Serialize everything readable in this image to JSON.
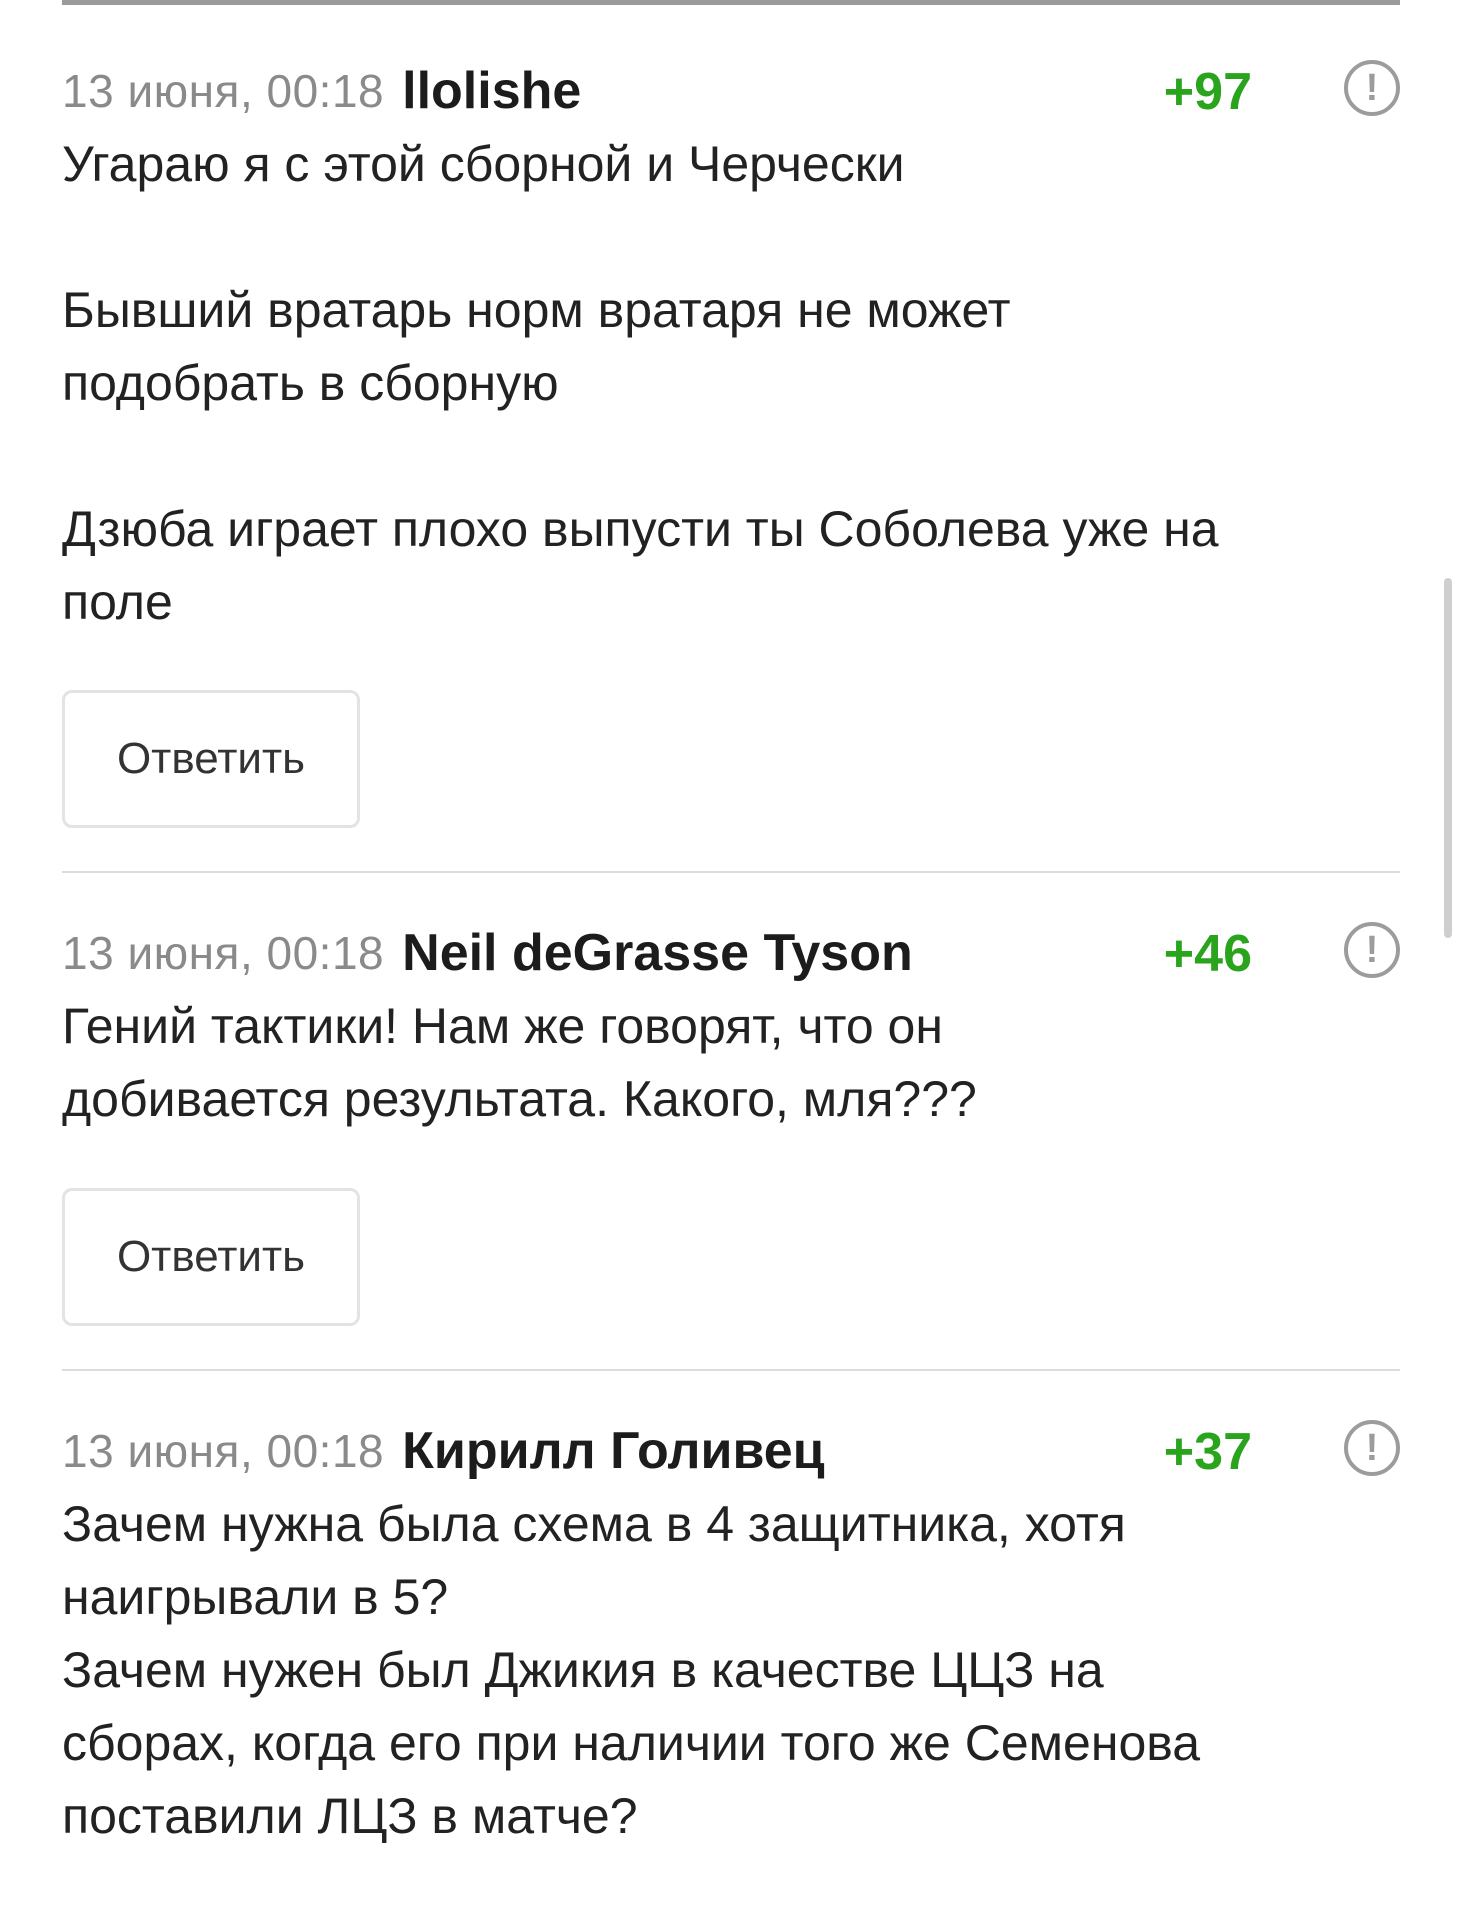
{
  "reply_label": "Ответить",
  "report_symbol": "!",
  "colors": {
    "rating_positive": "#2aa31d",
    "date": "#8a8a8a",
    "text": "#222222"
  },
  "comments": [
    {
      "date": "13 июня, 00:18",
      "author": "llolishe",
      "rating": "+97",
      "lines": [
        "Угараю я с этой сборной и Черчески",
        "",
        "Бывший вратарь норм вратаря не может",
        "подобрать в сборную",
        "",
        "Дзюба играет плохо выпусти ты Соболева уже на",
        "поле"
      ]
    },
    {
      "date": "13 июня, 00:18",
      "author": "Neil deGrasse Tyson",
      "rating": "+46",
      "lines": [
        "Гений тактики! Нам же говорят, что он",
        "добивается результата. Какого, мля???"
      ]
    },
    {
      "date": "13 июня, 00:18",
      "author": "Кирилл Голивец",
      "rating": "+37",
      "lines": [
        "Зачем нужна была схема в 4 защитника, хотя",
        "наигрывали в 5?",
        "Зачем нужен был Джикия в качестве ЦЦЗ на",
        "сборах, когда его при наличии того же Семенова",
        "поставили ЛЦЗ в матче?"
      ]
    }
  ]
}
